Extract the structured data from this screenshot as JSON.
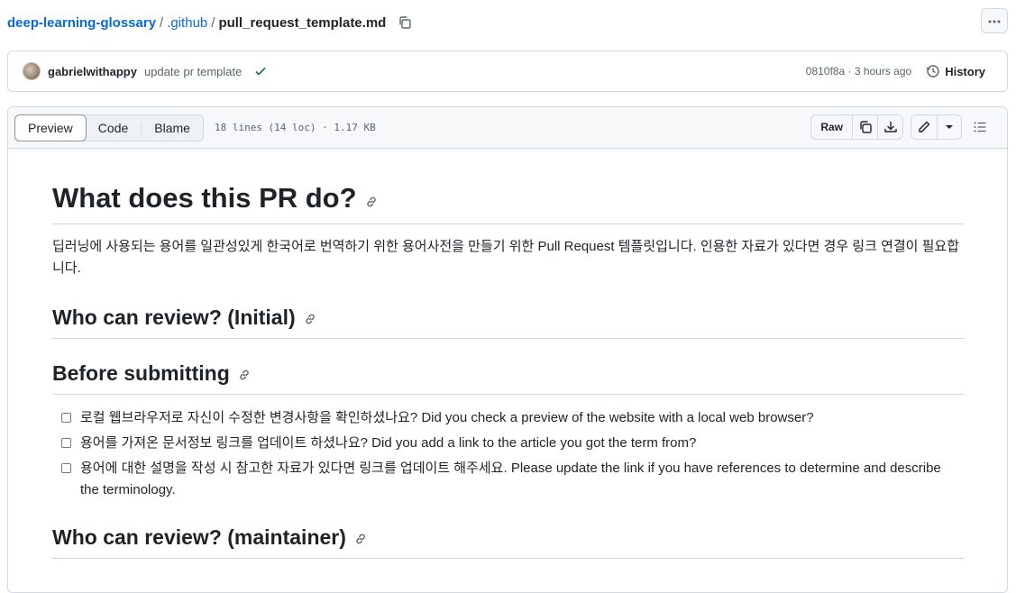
{
  "breadcrumb": {
    "repo": "deep-learning-glossary",
    "sep1": "/",
    "folder": ".github",
    "sep2": "/",
    "file": "pull_request_template.md"
  },
  "commit": {
    "author": "gabrielwithappy",
    "message": "update pr template",
    "sha_time": "0810f8a · 3 hours ago",
    "history_label": "History"
  },
  "viewer": {
    "tabs": [
      "Preview",
      "Code",
      "Blame"
    ],
    "active_tab": "Preview",
    "file_meta": "18 lines (14 loc) · 1.17 KB",
    "raw_label": "Raw"
  },
  "content": {
    "h1": "What does this PR do?",
    "intro": "딥러닝에 사용되는 용어를 일관성있게 한국어로 번역하기 위한 용어사전을 만들기 위한 Pull Request 템플릿입니다. 인용한 자료가 있다면 경우 링크 연결이 필요합니다.",
    "h2_initial": "Who can review? (Initial)",
    "h2_before": "Before submitting",
    "tasks": [
      "로컬 웹브라우저로 자신이 수정한 변경사항을 확인하셨나요? Did you check a preview of the website with a local web browser?",
      "용어를 가져온 문서정보 링크를 업데이트 하셨나요? Did you add a link to the article you got the term from?",
      "용어에 대한 설명을 작성 시 참고한 자료가 있다면 링크를 업데이트 해주세요. Please update the link if you have references to determine and describe the terminology."
    ],
    "h2_maintainer": "Who can review? (maintainer)"
  },
  "colors": {
    "link": "#0969da",
    "check": "#1a7f37",
    "border": "#d1d9e0"
  }
}
